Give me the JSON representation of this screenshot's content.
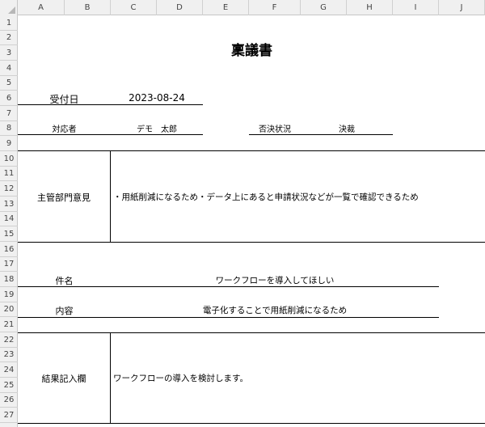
{
  "columns": [
    "A",
    "B",
    "C",
    "D",
    "E",
    "F",
    "G",
    "H",
    "I",
    "J"
  ],
  "rows": [
    "1",
    "2",
    "3",
    "4",
    "5",
    "6",
    "7",
    "8",
    "9",
    "10",
    "11",
    "12",
    "13",
    "14",
    "15",
    "16",
    "17",
    "18",
    "19",
    "20",
    "21",
    "22",
    "23",
    "24",
    "25",
    "26",
    "27"
  ],
  "document": {
    "title": "稟議書",
    "received_date_label": "受付日",
    "received_date_value": "2023-08-24",
    "handler_label": "対応者",
    "handler_value": "デモ　太郎",
    "approval_status_label": "否決状況",
    "approval_status_value": "決裁",
    "dept_opinion_label": "主管部門意見",
    "dept_opinion_value": "・用紙削減になるため・データ上にあると申請状況などが一覧で確認できるため",
    "subject_label": "件名",
    "subject_value": "ワークフローを導入してほしい",
    "content_label": "内容",
    "content_value": "電子化することで用紙削減になるため",
    "result_label": "結果記入欄",
    "result_value": "ワークフローの導入を検討します。"
  }
}
